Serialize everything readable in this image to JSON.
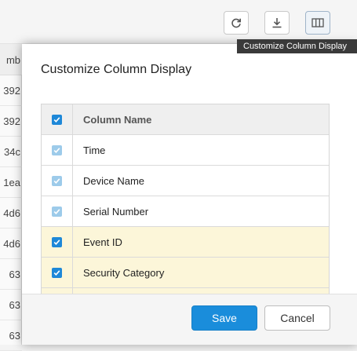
{
  "toolbar": {
    "buttons": [
      {
        "name": "refresh-icon"
      },
      {
        "name": "download-icon"
      },
      {
        "name": "columns-icon"
      }
    ],
    "tooltip": "Customize Column Display"
  },
  "background_table": {
    "header_fragment": "mb",
    "cells": [
      "392",
      "392",
      "34c",
      "1ea",
      "4d6",
      "4d6",
      "63",
      "63",
      "63"
    ]
  },
  "modal": {
    "title": "Customize Column Display",
    "header_label": "Column Name",
    "rows": [
      {
        "label": "Time",
        "checked": true,
        "disabled": true,
        "highlighted": false
      },
      {
        "label": "Device Name",
        "checked": true,
        "disabled": true,
        "highlighted": false
      },
      {
        "label": "Serial Number",
        "checked": true,
        "disabled": true,
        "highlighted": false
      },
      {
        "label": "Event ID",
        "checked": true,
        "disabled": false,
        "highlighted": true
      },
      {
        "label": "Security Category",
        "checked": true,
        "disabled": false,
        "highlighted": true
      },
      {
        "label": "",
        "checked": false,
        "disabled": false,
        "highlighted": true
      }
    ],
    "save_label": "Save",
    "cancel_label": "Cancel"
  },
  "colors": {
    "accent": "#1a8ddb",
    "checkbox": "#1e88d8",
    "checkbox_disabled": "#9dcbea",
    "highlight_row": "#fcf6d9"
  }
}
